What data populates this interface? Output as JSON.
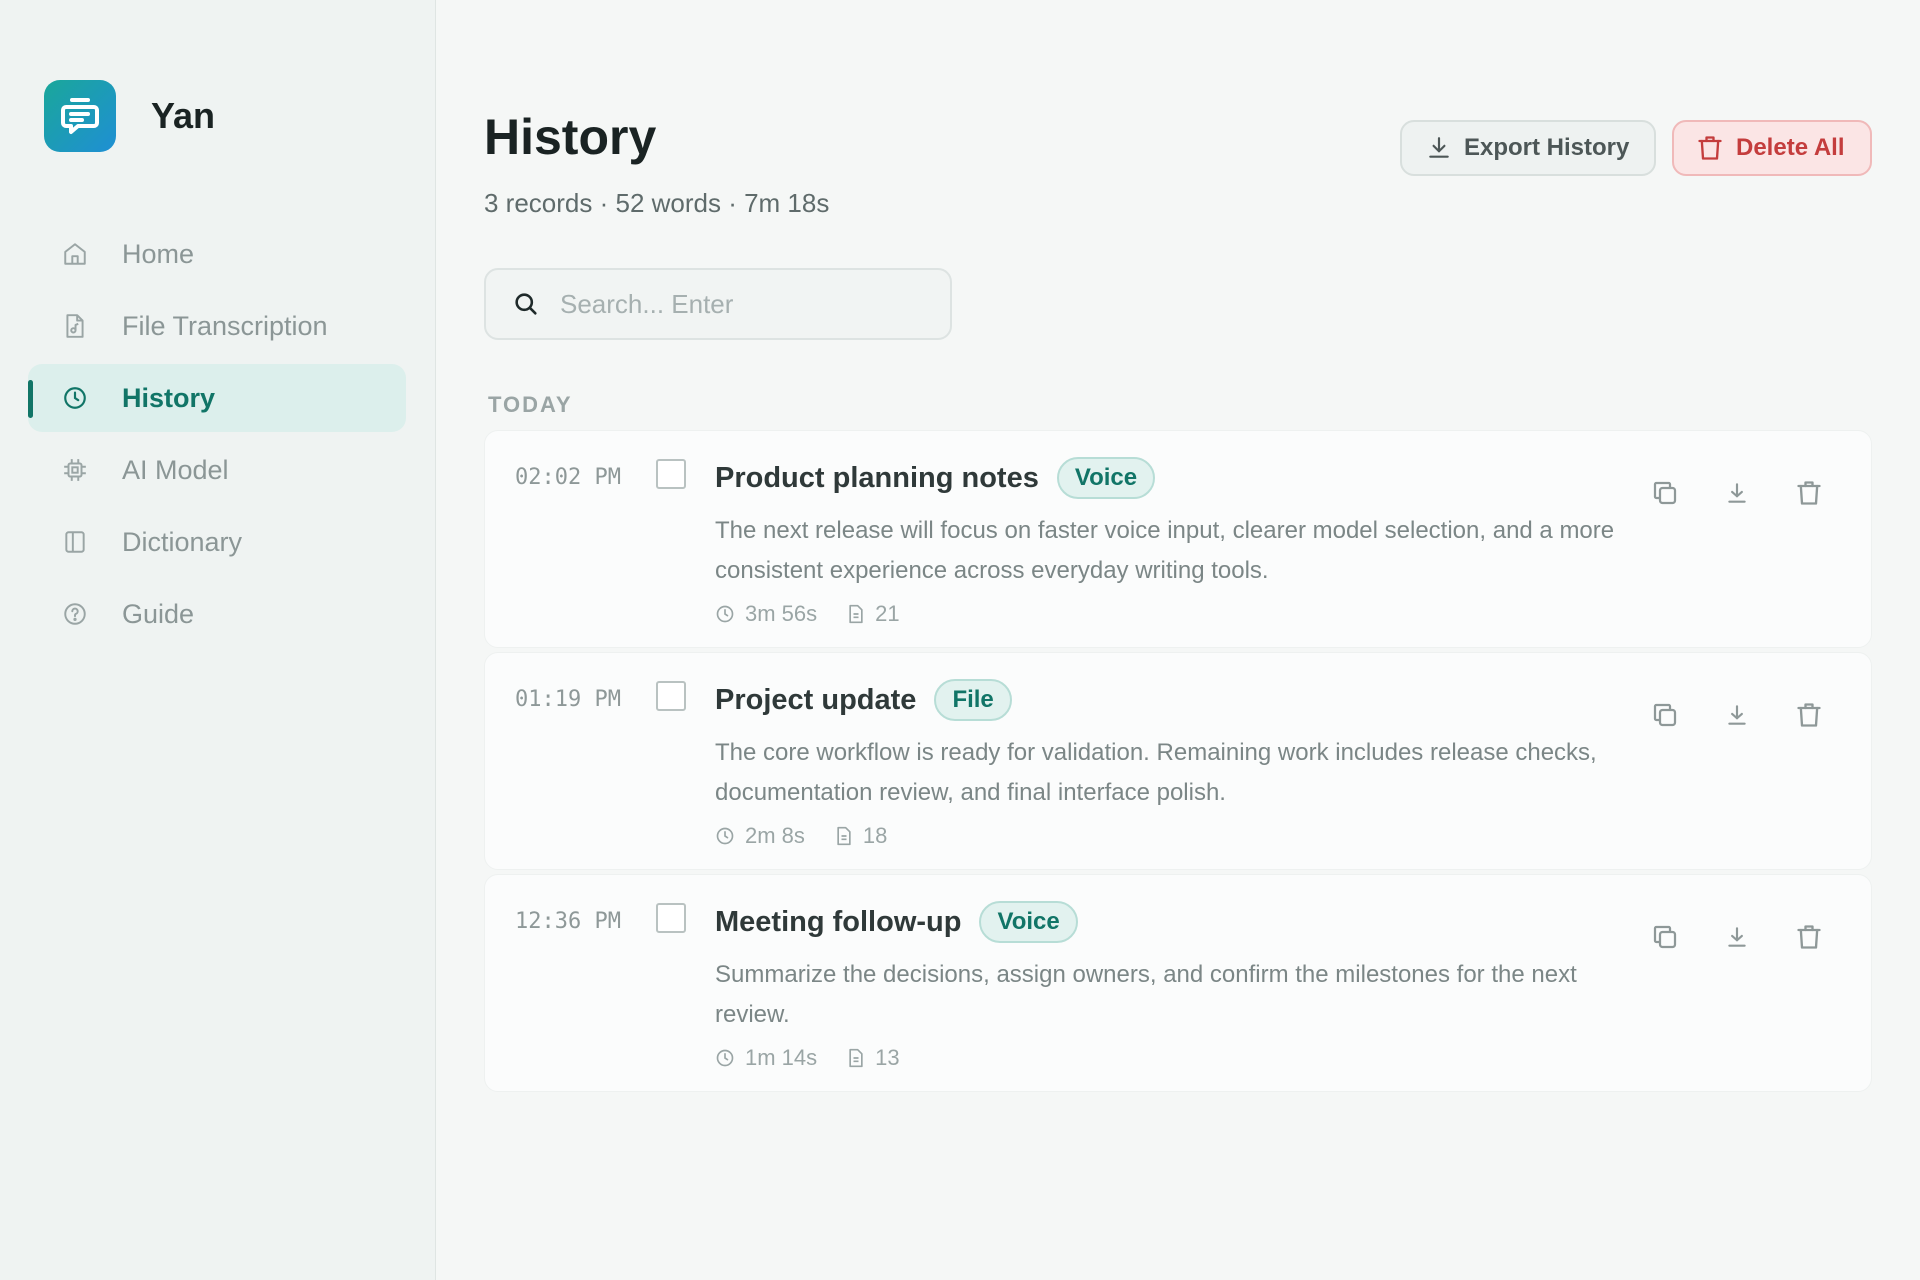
{
  "app": {
    "name": "Yan"
  },
  "sidebar": {
    "items": [
      {
        "label": "Home",
        "icon": "home-icon",
        "active": false
      },
      {
        "label": "File Transcription",
        "icon": "file-audio-icon",
        "active": false
      },
      {
        "label": "History",
        "icon": "clock-icon",
        "active": true
      },
      {
        "label": "AI Model",
        "icon": "chip-icon",
        "active": false
      },
      {
        "label": "Dictionary",
        "icon": "book-icon",
        "active": false
      },
      {
        "label": "Guide",
        "icon": "help-circle-icon",
        "active": false
      }
    ]
  },
  "header": {
    "title": "History",
    "stats": "3 records · 52 words · 7m 18s",
    "export_label": "Export History",
    "delete_all_label": "Delete All"
  },
  "search": {
    "placeholder": "Search... Enter",
    "value": ""
  },
  "groups": [
    {
      "label": "TODAY",
      "records": [
        {
          "time": "02:02 PM",
          "title": "Product planning notes",
          "badge": "Voice",
          "text": "The next release will focus on faster voice input, clearer model selection, and a more consistent experience across everyday writing tools.",
          "duration": "3m 56s",
          "words": "21"
        },
        {
          "time": "01:19 PM",
          "title": "Project update",
          "badge": "File",
          "text": "The core workflow is ready for validation. Remaining work includes release checks, documentation review, and final interface polish.",
          "duration": "2m 8s",
          "words": "18"
        },
        {
          "time": "12:36 PM",
          "title": "Meeting follow-up",
          "badge": "Voice",
          "text": "Summarize the decisions, assign owners, and confirm the milestones for the next review.",
          "duration": "1m 14s",
          "words": "13"
        }
      ]
    }
  ],
  "colors": {
    "accent": "#117567",
    "danger": "#c43d3d",
    "logo_start": "#1aa79a",
    "logo_end": "#1f8fd4"
  }
}
